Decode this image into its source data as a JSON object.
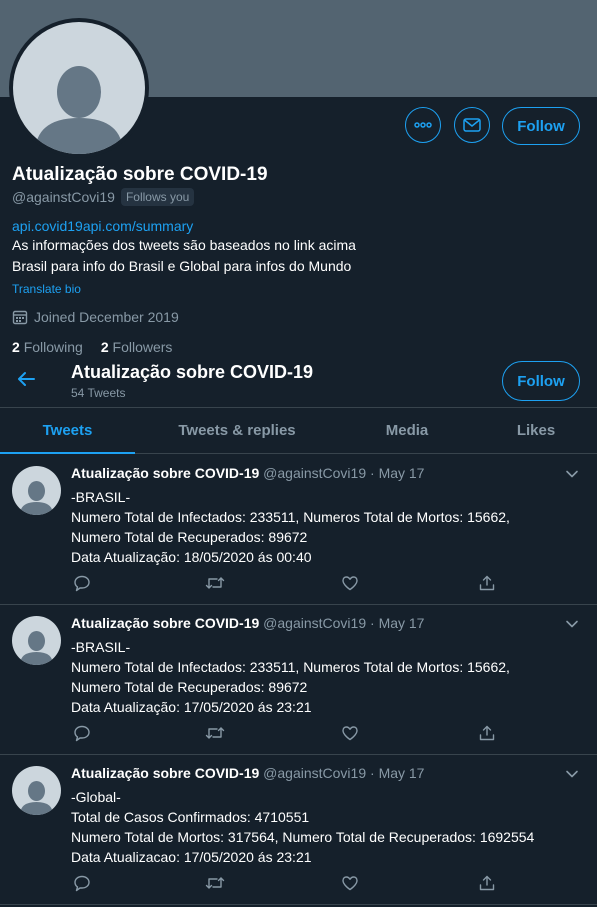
{
  "profile": {
    "name": "Atualização sobre COVID-19",
    "handle": "@againstCovi19",
    "follows_you": "Follows you",
    "bio_link": "api.covid19api.com/summary",
    "bio_lines": [
      "As informações dos tweets são baseados no link acima",
      "Brasil para info do Brasil e Global para infos do Mundo"
    ],
    "translate": "Translate bio",
    "joined": "Joined December 2019",
    "following_count": "2",
    "following_label": "Following",
    "followers_count": "2",
    "followers_label": "Followers",
    "follow_label": "Follow"
  },
  "sticky_header": {
    "name": "Atualização sobre COVID-19",
    "tweet_count": "54 Tweets",
    "follow_label": "Follow"
  },
  "tabs": [
    {
      "label": "Tweets",
      "active": true
    },
    {
      "label": "Tweets & replies",
      "active": false
    },
    {
      "label": "Media",
      "active": false
    },
    {
      "label": "Likes",
      "active": false
    }
  ],
  "tweets": [
    {
      "name": "Atualização sobre COVID-19",
      "handle": "@againstCovi19",
      "sep": "·",
      "date": "May 17",
      "lines": [
        "-BRASIL-",
        "Numero Total de Infectados: 233511, Numeros Total de Mortos: 15662,",
        "Numero Total de Recuperados: 89672",
        "Data Atualização: 18/05/2020 ás 00:40"
      ]
    },
    {
      "name": "Atualização sobre COVID-19",
      "handle": "@againstCovi19",
      "sep": "·",
      "date": "May 17",
      "lines": [
        "-BRASIL-",
        "Numero Total de Infectados: 233511, Numeros Total de Mortos: 15662,",
        "Numero Total de Recuperados: 89672",
        "Data Atualização: 17/05/2020 ás 23:21"
      ]
    },
    {
      "name": "Atualização sobre COVID-19",
      "handle": "@againstCovi19",
      "sep": "·",
      "date": "May 17",
      "lines": [
        "-Global-",
        "Total de Casos Confirmados: 4710551",
        "Numero Total de Mortos: 317564, Numero Total de Recuperados: 1692554",
        "Data Atualizacao: 17/05/2020 ás 23:21"
      ]
    }
  ],
  "icons": {
    "more": "more-icon",
    "message": "mail-icon",
    "back": "back-arrow-icon",
    "calendar": "calendar-icon",
    "reply": "reply-icon",
    "retweet": "retweet-icon",
    "like": "heart-icon",
    "share": "share-icon",
    "caret": "chevron-down-icon"
  },
  "colors": {
    "background": "#15202b",
    "accent": "#1da1f2",
    "secondary_text": "#8899a6",
    "banner": "#536471",
    "border": "#38444d"
  }
}
